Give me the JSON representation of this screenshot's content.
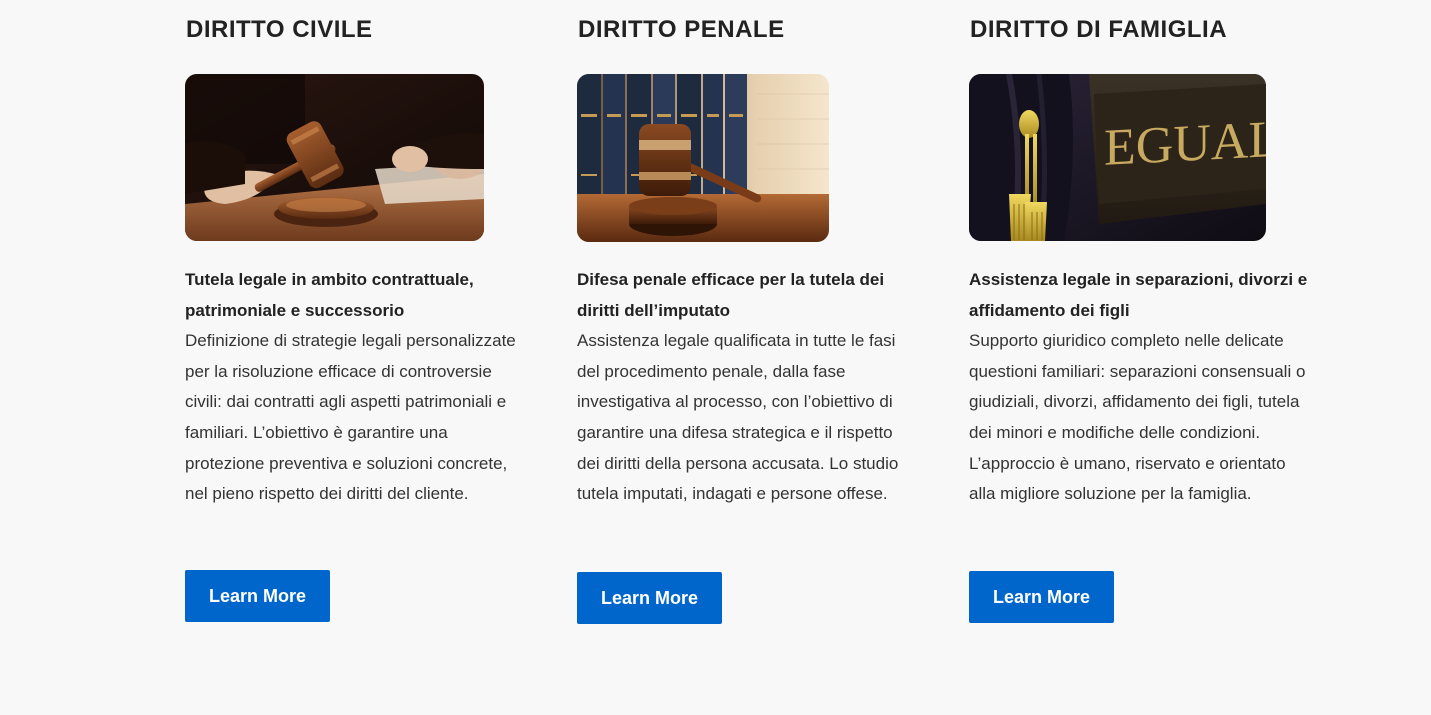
{
  "colors": {
    "background": "#f8f8f8",
    "button": "#0066cc",
    "button_text": "#ffffff",
    "heading": "#222222",
    "text": "#333333"
  },
  "cards": [
    {
      "title": "DIRITTO CIVILE",
      "image": "judge-gavel-photo",
      "subtitle": "Tutela legale in ambito contrattuale, patrimoniale e successorio",
      "body": "Definizione di strategie legali personalizzate per la risoluzione efficace di controversie civili: dai contratti agli aspetti patrimoniali e familiari. L’obiettivo è garantire una protezione preventiva e soluzioni concrete, nel pieno rispetto dei diritti del cliente.",
      "button_label": "Learn More"
    },
    {
      "title": "DIRITTO PENALE",
      "image": "gavel-law-books-photo",
      "subtitle": "Difesa penale efficace per la tutela dei diritti dell’imputato",
      "body": "Assistenza legale qualificata in tutte le fasi del procedimento penale, dalla fase investigativa al processo, con l’obiettivo di garantire una difesa strategica e il rispetto dei diritti della persona accusata. Lo studio tutela imputati, indagati e persone offese.",
      "button_label": "Learn More"
    },
    {
      "title": "DIRITTO DI FAMIGLIA",
      "image": "eguale-sign-robe-photo",
      "image_sign_text": "EGUALE",
      "subtitle": "Assistenza legale in separazioni, divorzi e affidamento dei figli",
      "body": "Supporto giuridico completo nelle delicate questioni familiari: separazioni consensuali o giudiziali, divorzi, affidamento dei figli, tutela dei minori e modifiche delle condizioni. L’approccio è umano, riservato e orientato alla migliore soluzione per la famiglia.",
      "button_label": "Learn More"
    }
  ]
}
